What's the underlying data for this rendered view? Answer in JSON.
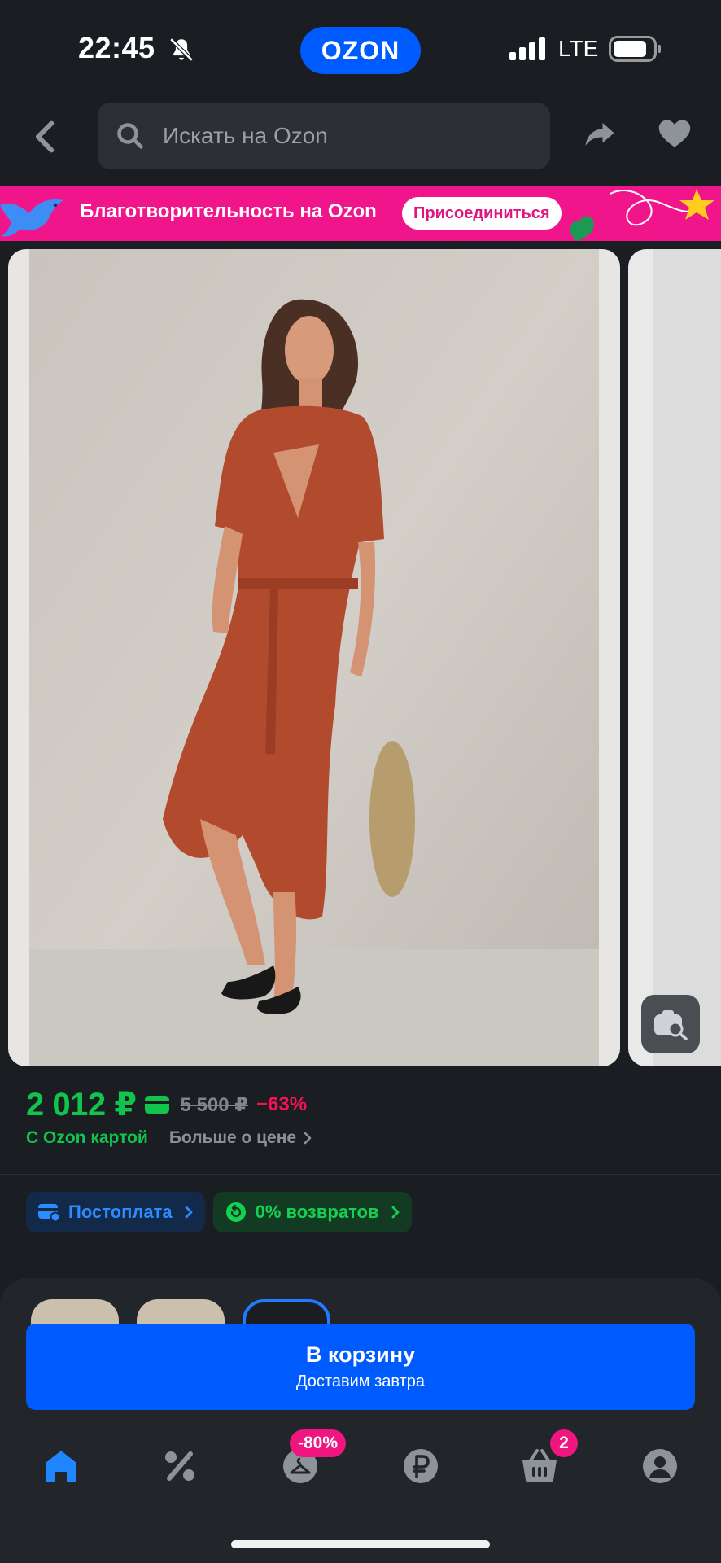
{
  "status_bar": {
    "time": "22:45",
    "brand_pill": "OZON",
    "network": "LTE",
    "icons": [
      "bell-off-icon",
      "signal-icon",
      "battery-icon"
    ]
  },
  "search": {
    "placeholder": "Искать на Ozon",
    "icons": [
      "back-icon",
      "search-icon",
      "share-icon",
      "heart-icon"
    ]
  },
  "banner": {
    "text": "Благотворительность на Ozon",
    "button": "Присоединиться"
  },
  "product": {
    "image_alt": "",
    "price": "2 012 ₽",
    "old_price": "5 500 ₽",
    "discount": "−63%",
    "card_label": "С Ozon картой",
    "more_price": "Больше о цене",
    "chips": [
      {
        "label": "Постоплата",
        "icon": "card-pay-icon"
      },
      {
        "label": "0% возвратов",
        "icon": "return-icon"
      }
    ]
  },
  "cart": {
    "title": "В корзину",
    "subtitle": "Доставим завтра"
  },
  "nav": {
    "items": [
      {
        "name": "home",
        "icon": "home-icon"
      },
      {
        "name": "sale",
        "icon": "percent-icon"
      },
      {
        "name": "fresh",
        "icon": "hanger-icon",
        "badge": "-80%"
      },
      {
        "name": "finance",
        "icon": "ruble-icon"
      },
      {
        "name": "cart",
        "icon": "basket-icon",
        "badge": "2"
      },
      {
        "name": "profile",
        "icon": "profile-icon"
      }
    ]
  },
  "colors": {
    "brand_blue": "#005bff",
    "price_green": "#10c44c",
    "discount_pink": "#f91155",
    "banner_pink": "#f0158a"
  }
}
